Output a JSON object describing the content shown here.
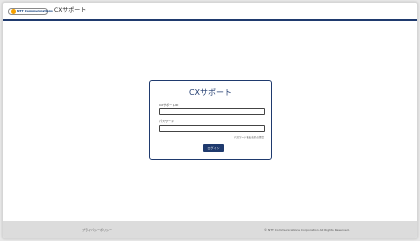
{
  "header": {
    "logo_text": "NTT Communications",
    "title": "CXサポート"
  },
  "login": {
    "title": "CXサポート",
    "id_label": "CXサポートID",
    "password_label": "パスワード",
    "forgot_link": "パスワードをお忘れの場合",
    "submit_label": "ログイン"
  },
  "footer": {
    "privacy_link": "プライバシーポリシー",
    "copyright": "© NTT Communications Corporation All Rights Reserved."
  },
  "colors": {
    "brand": "#1f3a6e",
    "logo_accent": "#f5a100",
    "footer_bg": "#dcdcdc"
  }
}
